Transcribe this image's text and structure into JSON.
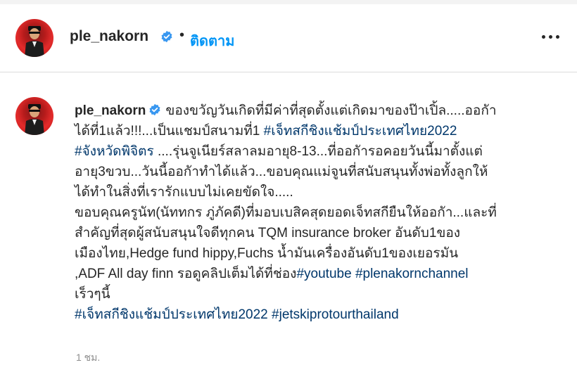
{
  "header": {
    "username": "ple_nakorn",
    "separator": "•",
    "follow_label": "ติดตาม"
  },
  "post": {
    "username": "ple_nakorn",
    "caption_lines": [
      {
        "text": "ของขวัญวันเกิดที่มีค่าที่สุดตั้งแต่เกิดมาของป๊าเปิ้ล.....ออกัา"
      },
      {
        "text": "ได้ที่1แล้ว!!!...เป็นแชมป์สนามที่1 ",
        "tag": "#เจ็ทสกีชิงแช้มป์ประเทศไทย2022"
      },
      {
        "tag": "#จังหวัดพิจิตร",
        "text": " ....รุ่นจูเนียร์สลาลมอายุ8-13...ที่ออกัารอคอยวันนี้มาตั้งแต่"
      },
      {
        "text": "อายุ3ขวบ...วันนี้ออกัาทำได้แล้ว...ขอบคุณแม่จูนที่สนับสนุนทั้งพ่อทั้งลูกให้"
      },
      {
        "text": "ได้ทำในสิ่งที่เรารักแบบไม่เคยขัดใจ....."
      },
      {
        "text": "ขอบคุณครูนัท(นัททกร ภู่ภัคดี)ที่มอบเบสิคสุดยอดเจ็ทสกียืนให้ออกัา...และที่"
      },
      {
        "text": "สำคัญที่สุดผู้สนับสนุนใจดีทุกคน TQM insurance broker อันดับ1ของ"
      },
      {
        "text": "เมืองไทย,Hedge fund hippy,Fuchs น้ำมันเครื่องอันดับ1ของเยอรมัน"
      },
      {
        "text": ",ADF All day finn รอดูคลิปเต็มได้ที่ช่อง",
        "tag": "#youtube",
        "tag2": "#plenakornchannel"
      },
      {
        "text": "เร็วๆนี้"
      },
      {
        "tag": "#เจ็ทสกีชิงแช้มป์ประเทศไทย2022",
        "tag2": "#jetskiprotourthailand"
      }
    ],
    "timestamp": "1 ชม."
  },
  "colors": {
    "follow": "#0095f6",
    "hashtag": "#00376b",
    "verified": "#3897f0",
    "timestamp": "#8e8e8e"
  },
  "icons": {
    "verified": "verified-badge-icon",
    "more": "more-options-icon"
  }
}
